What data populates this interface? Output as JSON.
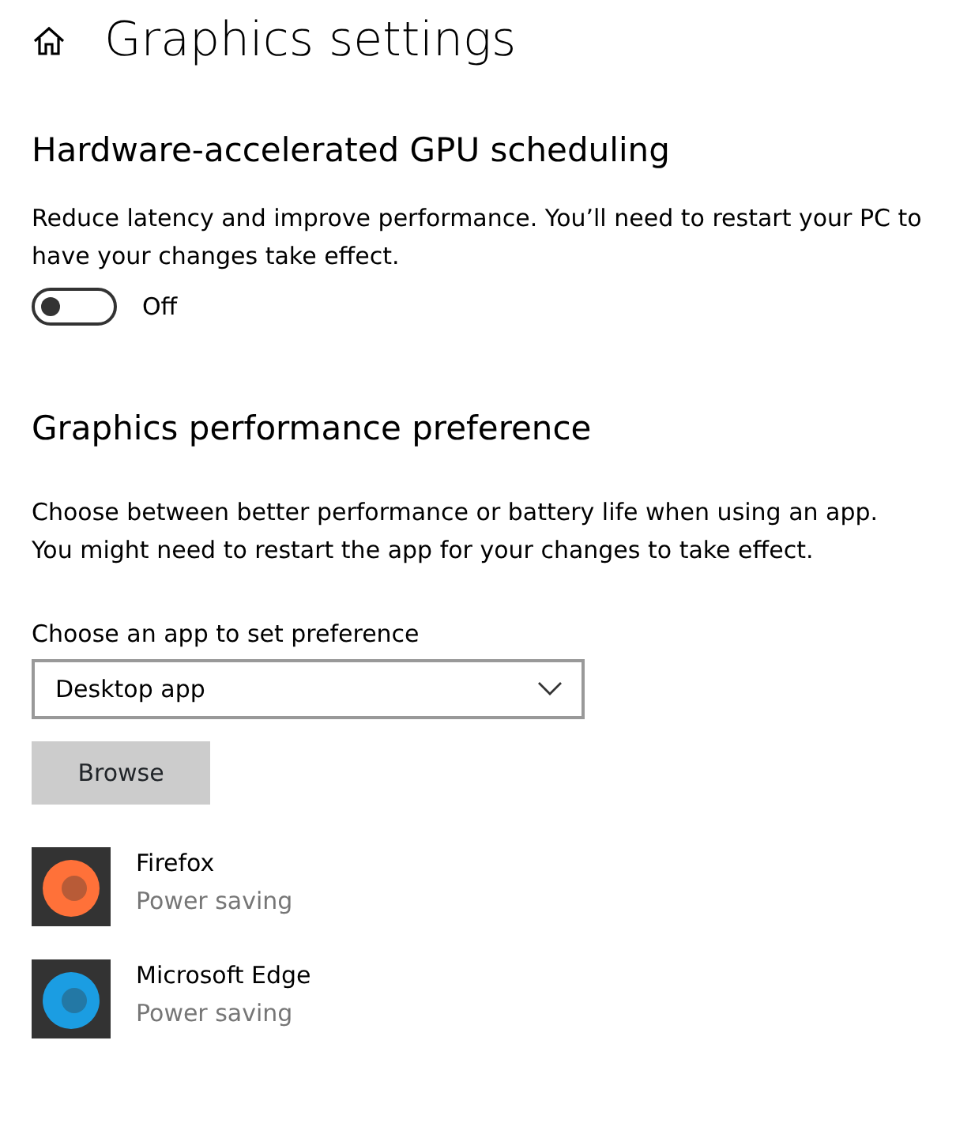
{
  "page_title": "Graphics settings",
  "gpu_scheduling": {
    "heading": "Hardware-accelerated GPU scheduling",
    "description": "Reduce latency and improve performance. You’ll need to restart your PC to have your changes take effect.",
    "toggle": {
      "on": false,
      "label": "Off"
    }
  },
  "performance": {
    "heading": "Graphics performance preference",
    "description": "Choose between better performance or battery life when using an app. You might need to restart the app for your changes to take effect.",
    "select_label": "Choose an app to set preference",
    "select_value": "Desktop app",
    "browse_button": "Browse"
  },
  "apps": [
    {
      "name": "Firefox",
      "preference": "Power saving",
      "color": "#ff7139"
    },
    {
      "name": "Microsoft Edge",
      "preference": "Power saving",
      "color": "#1b9de2"
    }
  ]
}
